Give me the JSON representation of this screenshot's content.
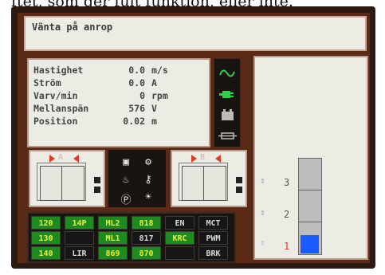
{
  "caption_text": "ftet, som ger fult funktion, eller inte.",
  "message": "Vänta på anrop",
  "readouts": [
    {
      "label": "Hastighet",
      "value": "0.0",
      "unit": "m/s"
    },
    {
      "label": "Ström",
      "value": "0.0",
      "unit": "A"
    },
    {
      "label": "Varv/min",
      "value": "0",
      "unit": "rpm"
    },
    {
      "label": "Mellanspän",
      "value": "576",
      "unit": "V"
    },
    {
      "label": "Position",
      "value": "0.02",
      "unit": "m"
    }
  ],
  "status_icons": [
    "sine-wave-icon",
    "power-plug-icon",
    "battery-icon",
    "fuse-icon"
  ],
  "doors": [
    {
      "tag": "A"
    },
    {
      "tag": "B"
    }
  ],
  "center_icons": [
    "ups-icon",
    "brake-icon",
    "fire-icon",
    "key-icon",
    "parking-icon",
    "light-icon"
  ],
  "signal_grid": [
    [
      {
        "text": "120",
        "state": "green"
      },
      {
        "text": "14P",
        "state": "green"
      },
      {
        "text": "ML2",
        "state": "green"
      },
      {
        "text": "818",
        "state": "green"
      },
      {
        "text": "EN",
        "state": "dark"
      },
      {
        "text": "MCT",
        "state": "dark"
      }
    ],
    [
      {
        "text": "130",
        "state": "green"
      },
      {
        "text": "",
        "state": "dark"
      },
      {
        "text": "ML1",
        "state": "green"
      },
      {
        "text": "817",
        "state": "dark"
      },
      {
        "text": "KRC",
        "state": "green"
      },
      {
        "text": "PWM",
        "state": "dark"
      }
    ],
    [
      {
        "text": "140",
        "state": "green"
      },
      {
        "text": "LIR",
        "state": "dark"
      },
      {
        "text": "869",
        "state": "green"
      },
      {
        "text": "870",
        "state": "green"
      },
      {
        "text": "",
        "state": "dark"
      },
      {
        "text": "BRK",
        "state": "dark"
      }
    ]
  ],
  "floors": [
    {
      "number": "3"
    },
    {
      "number": "2"
    },
    {
      "number": "1"
    }
  ],
  "colors": {
    "active_cell": "#1f8a1f",
    "active_text": "#e9f03a",
    "car": "#1a5bff",
    "door_arrow": "#e23a2a"
  }
}
